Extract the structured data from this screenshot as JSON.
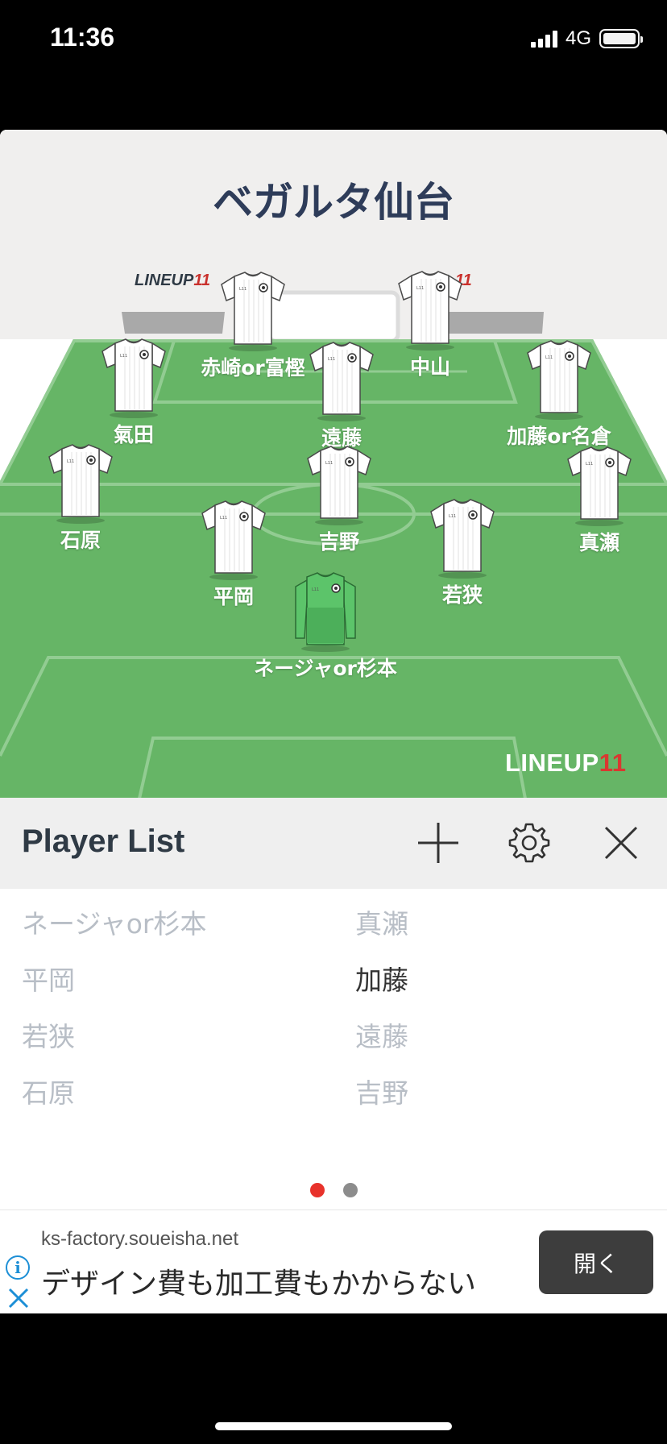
{
  "status_bar": {
    "time": "11:36",
    "network": "4G"
  },
  "team_name": "ベガルタ仙台",
  "pitch": {
    "brand": "LINEUP11",
    "brand_main": "LINEUP",
    "brand_num": "11"
  },
  "players": [
    {
      "name": "赤崎or富樫",
      "role": "outfield"
    },
    {
      "name": "中山",
      "role": "outfield"
    },
    {
      "name": "氣田",
      "role": "outfield"
    },
    {
      "name": "遠藤",
      "role": "outfield"
    },
    {
      "name": "加藤or名倉",
      "role": "outfield"
    },
    {
      "name": "石原",
      "role": "outfield"
    },
    {
      "name": "吉野",
      "role": "outfield"
    },
    {
      "name": "真瀬",
      "role": "outfield"
    },
    {
      "name": "平岡",
      "role": "outfield"
    },
    {
      "name": "若狭",
      "role": "outfield"
    },
    {
      "name": "ネージャor杉本",
      "role": "goalkeeper"
    }
  ],
  "player_list": {
    "title": "Player List",
    "icons": [
      "plus-icon",
      "gear-icon",
      "close-icon"
    ],
    "left_column": [
      "ネージャor杉本",
      "平岡",
      "若狭",
      "石原"
    ],
    "right_column": [
      "真瀬",
      "加藤",
      "遠藤",
      "吉野"
    ],
    "highlighted": "加藤"
  },
  "pager": {
    "count": 2,
    "active": 1
  },
  "ad": {
    "url": "ks-factory.soueisha.net",
    "text": "デザイン費も加工費もかからない",
    "button_label": "開く"
  },
  "colors": {
    "pitch": "#66b566",
    "title": "#2e3c59",
    "accent_red": "#e8322b"
  }
}
